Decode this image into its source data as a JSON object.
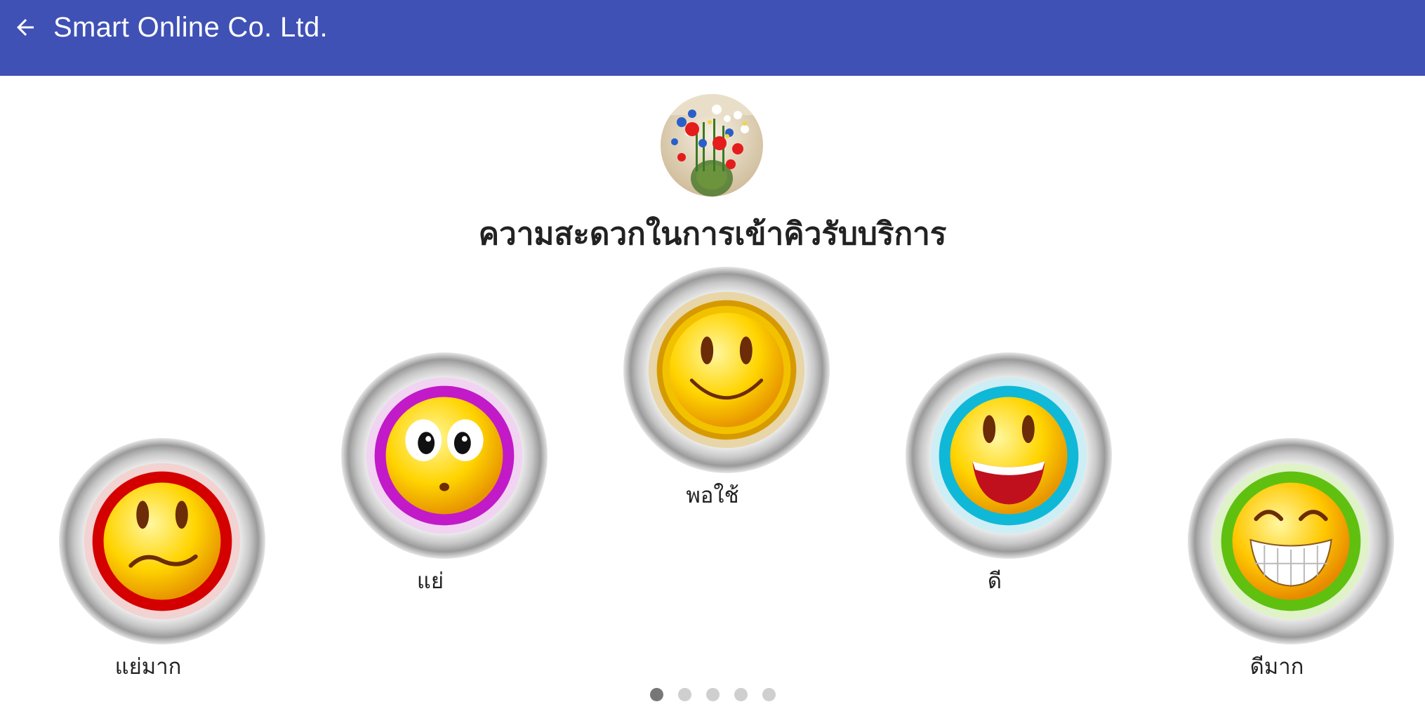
{
  "appbar": {
    "title": "Smart Online Co. Ltd.",
    "back_icon": "arrow-left-icon",
    "color": "#3f51b5"
  },
  "avatar": {
    "icon": "flower-vase-image"
  },
  "survey": {
    "question": "ความสะดวกในการเข้าคิวรับบริการ",
    "options": [
      {
        "label": "แย่มาก",
        "icon": "very-sad-face-icon",
        "ring_color": "#e01010"
      },
      {
        "label": "แย่",
        "icon": "surprised-face-icon",
        "ring_color": "#c020c8"
      },
      {
        "label": "พอใช้",
        "icon": "neutral-smile-icon",
        "ring_color": "#e0a000"
      },
      {
        "label": "ดี",
        "icon": "happy-face-icon",
        "ring_color": "#10b8d8"
      },
      {
        "label": "ดีมาก",
        "icon": "grinning-face-icon",
        "ring_color": "#60c010"
      }
    ]
  },
  "pager": {
    "total": 5,
    "active_index": 0
  }
}
